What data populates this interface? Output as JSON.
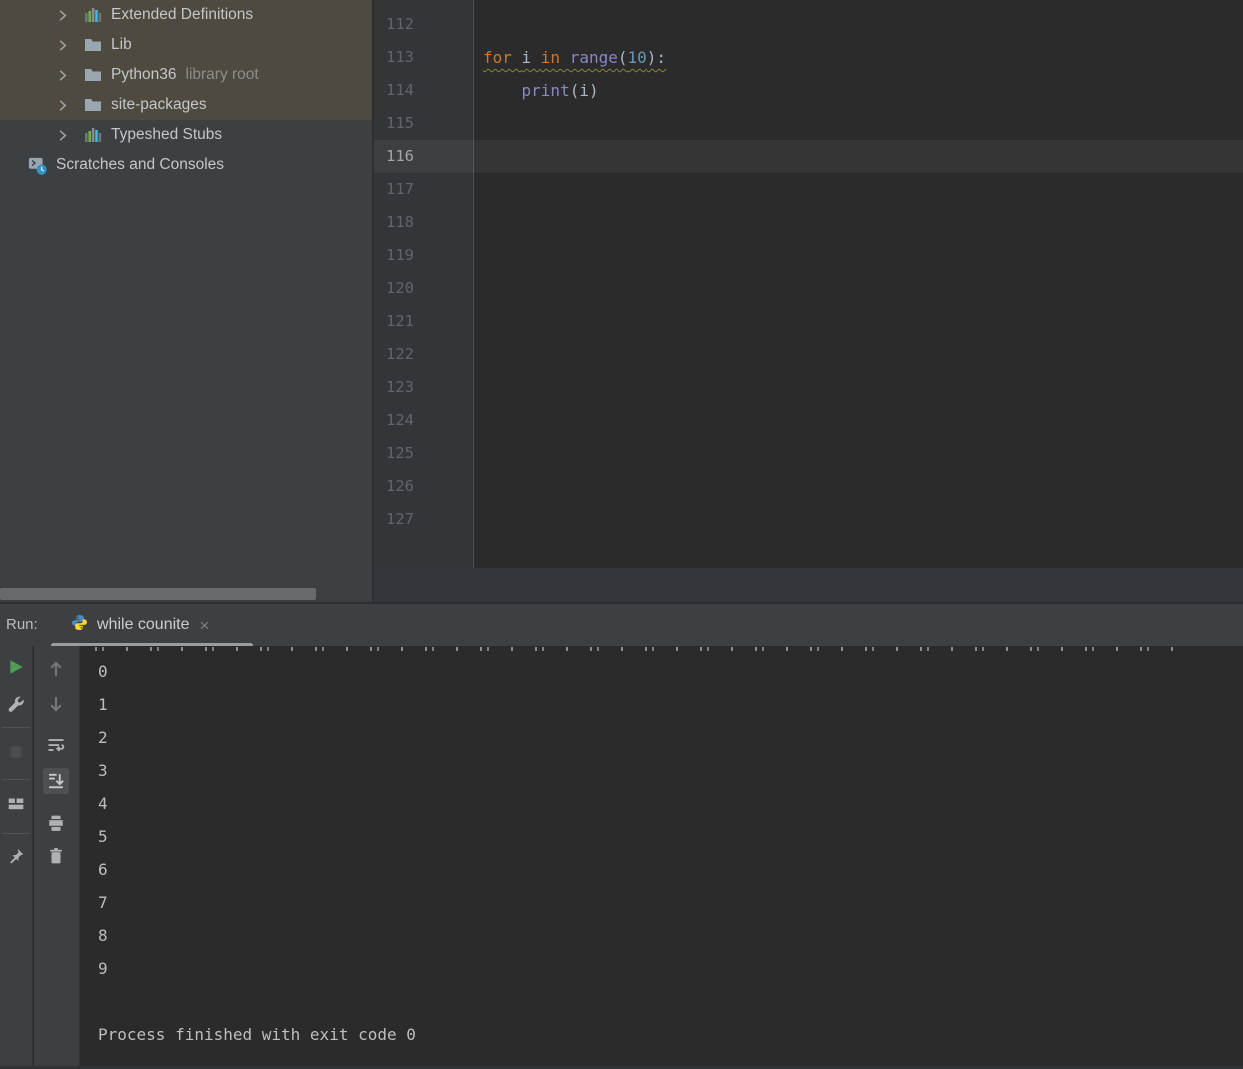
{
  "colors": {
    "selection_bg": "#4e4a40",
    "keyword": "#cc7832",
    "builtin": "#8888c6",
    "number": "#6897bb",
    "code_text": "#a9b7c6",
    "warning_underline": "#8c8437",
    "python_blue": "#4B8BBE",
    "python_yellow": "#FFD43B",
    "run_green": "#4d9e52"
  },
  "project_tree": {
    "items": [
      {
        "label": "Extended Definitions",
        "suffix": "",
        "icon": "library-icon",
        "chevron": true,
        "indent": 1,
        "selected": true
      },
      {
        "label": "Lib",
        "suffix": "",
        "icon": "folder-icon",
        "chevron": true,
        "indent": 1,
        "selected": true
      },
      {
        "label": "Python36",
        "suffix": "library root",
        "icon": "folder-icon",
        "chevron": true,
        "indent": 1,
        "selected": true
      },
      {
        "label": "site-packages",
        "suffix": "",
        "icon": "folder-icon",
        "chevron": true,
        "indent": 1,
        "selected": true
      },
      {
        "label": "Typeshed Stubs",
        "suffix": "",
        "icon": "library-icon",
        "chevron": true,
        "indent": 1,
        "selected": false
      },
      {
        "label": "Scratches and Consoles",
        "suffix": "",
        "icon": "scratches-icon",
        "chevron": false,
        "indent": 0,
        "selected": false
      }
    ]
  },
  "editor": {
    "current_line": "116",
    "lines": [
      {
        "n": "112",
        "tokens": []
      },
      {
        "n": "113",
        "warn_underline": true,
        "tokens": [
          {
            "t": "for ",
            "c": "keyword"
          },
          {
            "t": "i ",
            "c": "plain"
          },
          {
            "t": "in ",
            "c": "keyword"
          },
          {
            "t": "range",
            "c": "builtin"
          },
          {
            "t": "(",
            "c": "plain"
          },
          {
            "t": "10",
            "c": "number"
          },
          {
            "t": "):",
            "c": "plain"
          }
        ]
      },
      {
        "n": "114",
        "tokens": [
          {
            "t": "    ",
            "c": "plain"
          },
          {
            "t": "print",
            "c": "builtin"
          },
          {
            "t": "(i)",
            "c": "plain"
          }
        ]
      },
      {
        "n": "115",
        "tokens": []
      },
      {
        "n": "116",
        "tokens": []
      },
      {
        "n": "117",
        "tokens": []
      },
      {
        "n": "118",
        "tokens": []
      },
      {
        "n": "119",
        "tokens": []
      },
      {
        "n": "120",
        "tokens": []
      },
      {
        "n": "121",
        "tokens": []
      },
      {
        "n": "122",
        "tokens": []
      },
      {
        "n": "123",
        "tokens": []
      },
      {
        "n": "124",
        "tokens": []
      },
      {
        "n": "125",
        "tokens": []
      },
      {
        "n": "126",
        "tokens": []
      },
      {
        "n": "127",
        "tokens": []
      }
    ]
  },
  "run_panel": {
    "label": "Run:",
    "tab": {
      "title": "while counite",
      "icon": "python-icon",
      "close_glyph": "×"
    },
    "toolbar_main": [
      {
        "name": "rerun",
        "icon": "rerun-icon",
        "disabled": false,
        "selected": false
      },
      {
        "name": "settings",
        "icon": "wrench-icon",
        "disabled": false,
        "selected": false
      },
      {
        "name": "stop",
        "icon": "stop-icon",
        "disabled": true,
        "selected": false
      },
      {
        "name": "restore-layout",
        "icon": "layout-icon",
        "disabled": false,
        "selected": false
      },
      {
        "name": "pin",
        "icon": "pin-icon",
        "disabled": false,
        "selected": false
      }
    ],
    "toolbar_console": [
      {
        "name": "scroll-up",
        "icon": "arrow-up-icon",
        "disabled": false,
        "selected": false
      },
      {
        "name": "scroll-down",
        "icon": "arrow-down-icon",
        "disabled": false,
        "selected": false
      },
      {
        "name": "soft-wrap",
        "icon": "soft-wrap-icon",
        "disabled": false,
        "selected": false
      },
      {
        "name": "scroll-to-end",
        "icon": "scroll-end-icon",
        "disabled": false,
        "selected": true
      },
      {
        "name": "print",
        "icon": "print-icon",
        "disabled": false,
        "selected": false
      },
      {
        "name": "clear-all",
        "icon": "trash-icon",
        "disabled": false,
        "selected": false
      }
    ],
    "console_lines": [
      "0",
      "1",
      "2",
      "3",
      "4",
      "5",
      "6",
      "7",
      "8",
      "9",
      "",
      "Process finished with exit code 0"
    ]
  }
}
